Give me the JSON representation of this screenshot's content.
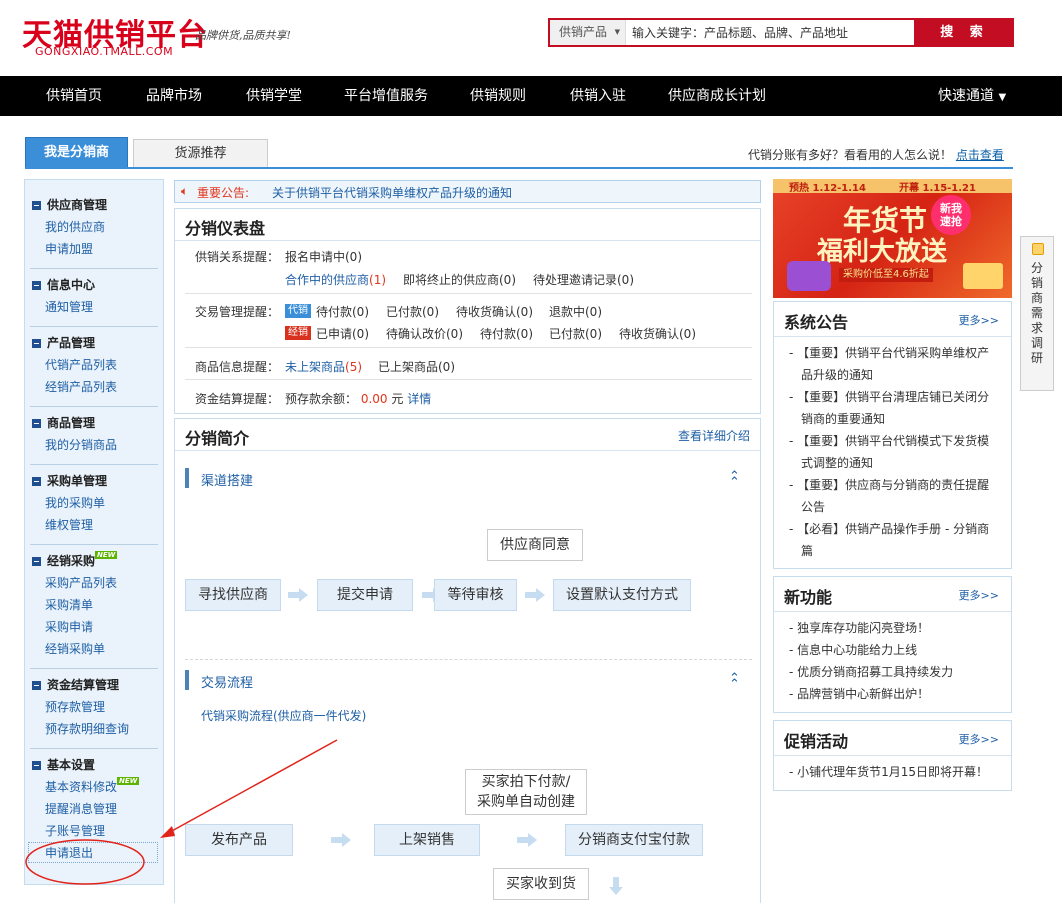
{
  "header": {
    "logo_cn": "天猫供销平台",
    "logo_en": "GONGXIAO.TMALL.COM",
    "slogan": "品牌供货,品质共享!",
    "search": {
      "category": "供销产品",
      "placeholder": "输入关键字：产品标题、品牌、产品地址",
      "button": "搜 索"
    }
  },
  "nav": {
    "items": [
      "供销首页",
      "品牌市场",
      "供销学堂",
      "平台增值服务",
      "供销规则",
      "供销入驻",
      "供应商成长计划"
    ],
    "quick": "快速通道"
  },
  "tabs": {
    "active": "我是分销商",
    "second": "货源推荐"
  },
  "promo": {
    "question": "代销分账有多好？看看用的人怎么说！",
    "link": "点击查看"
  },
  "sidebar": {
    "groups": [
      {
        "title": "供应商管理",
        "items": [
          "我的供应商",
          "申请加盟"
        ]
      },
      {
        "title": "信息中心",
        "items": [
          "通知管理"
        ]
      },
      {
        "title": "产品管理",
        "items": [
          "代销产品列表",
          "经销产品列表"
        ]
      },
      {
        "title": "商品管理",
        "items": [
          "我的分销商品"
        ]
      },
      {
        "title": "采购单管理",
        "items": [
          "我的采购单",
          "维权管理"
        ]
      },
      {
        "title": "经销采购",
        "items": [
          "采购产品列表",
          "采购清单",
          "采购申请",
          "经销采购单"
        ]
      },
      {
        "title": "资金结算管理",
        "items": [
          "预存款管理",
          "预存款明细查询"
        ]
      },
      {
        "title": "基本设置",
        "items": [
          "基本资料修改",
          "提醒消息管理",
          "子账号管理",
          "申请退出"
        ]
      }
    ],
    "new_badge": "NEW"
  },
  "notice": {
    "label": "重要公告:",
    "text": "关于供销平台代销采购单维权产品升级的通知"
  },
  "dashboard": {
    "title": "分销仪表盘",
    "rel_label": "供销关系提醒：",
    "rel_row1": "报名申请中(0)",
    "rel_row2a": "合作中的供应商",
    "rel_row2a_count": "(1)",
    "rel_row2b": "即将终止的供应商(0)",
    "rel_row2c": "待处理邀请记录(0)",
    "trade_label": "交易管理提醒：",
    "tag_daixiao": "代销",
    "trade_row1": [
      "待付款(0)",
      "已付款(0)",
      "待收货确认(0)",
      "退款中(0)"
    ],
    "tag_jingxiao": "经销",
    "trade_row2": [
      "已申请(0)",
      "待确认改价(0)",
      "待付款(0)",
      "已付款(0)",
      "待收货确认(0)"
    ],
    "goods_label": "商品信息提醒：",
    "goods_unlisted": "未上架商品",
    "goods_unlisted_count": "(5)",
    "goods_listed": "已上架商品(0)",
    "fund_label": "资金结算提醒：",
    "fund_text": "预存款余额：",
    "fund_amount": "0.00",
    "fund_unit": "元",
    "fund_detail": "详情"
  },
  "intro": {
    "title": "分销简介",
    "more": "查看详细介绍",
    "channel_title": "渠道搭建",
    "channel_flow": [
      "寻找供应商",
      "提交申请",
      "等待审核",
      "设置默认支付方式"
    ],
    "channel_note": "供应商同意",
    "trade_title": "交易流程",
    "trade_sub": "代销采购流程(供应商一件代发)",
    "trade_flow": [
      "发布产品",
      "上架销售",
      "分销商支付宝付款"
    ],
    "trade_note1": "买家拍下付款/",
    "trade_note2": "采购单自动创建",
    "trade_next": "买家收到货"
  },
  "banner": {
    "preheat": "预热 1.12-1.14",
    "open": "开幕 1.15-1.21",
    "line1": "年货节",
    "line2": "福利大放送",
    "badge1": "新我",
    "badge2": "速抢",
    "sub": "采购价低至4.6折起"
  },
  "announcements": {
    "title": "系统公告",
    "more": "更多>>",
    "items": [
      "【重要】供销平台代销采购单维权产",
      "品升级的通知",
      "【重要】供销平台清理店铺已关闭分",
      "销商的重要通知",
      "【重要】供销平台代销模式下发货模",
      "式调整的通知",
      "【重要】供应商与分销商的责任提醒",
      "公告",
      "【必看】供销产品操作手册 - 分销商",
      "篇"
    ]
  },
  "features": {
    "title": "新功能",
    "more": "更多>>",
    "items": [
      "独享库存功能闪亮登场！",
      "信息中心功能给力上线",
      "优质分销商招募工具持续发力",
      "品牌营销中心新鲜出炉！"
    ]
  },
  "promos": {
    "title": "促销活动",
    "more": "更多>>",
    "items": [
      "小铺代理年货节1月15日即将开幕！"
    ]
  },
  "survey": {
    "text": "分销商需求调研"
  },
  "colors": {
    "brand_red": "#d9001b",
    "accent_blue": "#3b8fd8",
    "annotation_red": "#e2231a"
  }
}
